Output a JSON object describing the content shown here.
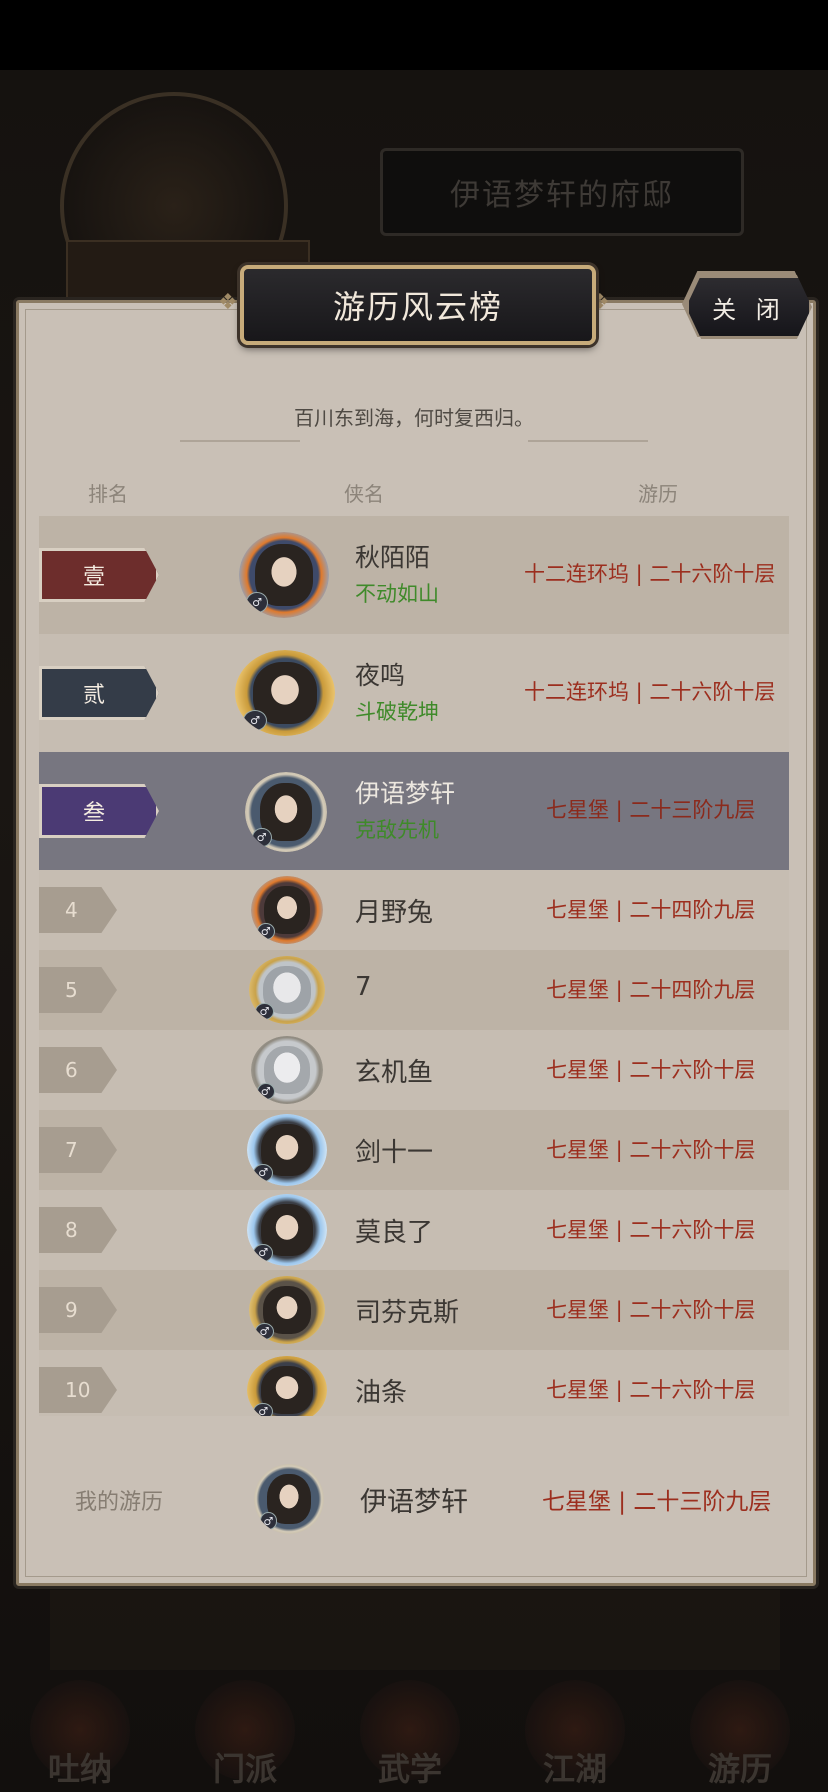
{
  "background": {
    "banner_text": "伊语梦轩的府邸",
    "nav_items": [
      "吐纳",
      "门派",
      "武学",
      "江湖",
      "游历"
    ]
  },
  "panel": {
    "title": "游历风云榜",
    "close_label": "关 闭",
    "subtitle": "百川东到海，何时复西归。",
    "columns": {
      "rank": "排名",
      "name": "侠名",
      "progress": "游历"
    }
  },
  "rows": [
    {
      "rank": "壹",
      "name": "秋陌陌",
      "title": "不动如山",
      "progress": "十二连环坞 | 二十六阶十层"
    },
    {
      "rank": "贰",
      "name": "夜鸣",
      "title": "斗破乾坤",
      "progress": "十二连环坞 | 二十六阶十层"
    },
    {
      "rank": "叁",
      "name": "伊语梦轩",
      "title": "克敌先机",
      "progress": "七星堡 | 二十三阶九层"
    },
    {
      "rank": "4",
      "name": "月野兔",
      "progress": "七星堡 | 二十四阶九层"
    },
    {
      "rank": "5",
      "name": "7",
      "progress": "七星堡 | 二十四阶九层"
    },
    {
      "rank": "6",
      "name": "玄机鱼",
      "progress": "七星堡 | 二十六阶十层"
    },
    {
      "rank": "7",
      "name": "剑十一",
      "progress": "七星堡 | 二十六阶十层"
    },
    {
      "rank": "8",
      "name": "莫良了",
      "progress": "七星堡 | 二十六阶十层"
    },
    {
      "rank": "9",
      "name": "司芬克斯",
      "progress": "七星堡 | 二十六阶十层"
    },
    {
      "rank": "10",
      "name": "油条",
      "progress": "七星堡 | 二十六阶十层"
    }
  ],
  "mine": {
    "label": "我的游历",
    "name": "伊语梦轩",
    "progress": "七星堡 | 二十三阶九层"
  },
  "colors": {
    "rank1": "#6d2d2c",
    "rank2": "#343c48",
    "rank3": "#4b3a74",
    "title_green": "#3f8a2a",
    "progress_red": "#9c2e1e",
    "highlight_row": "#777680"
  }
}
